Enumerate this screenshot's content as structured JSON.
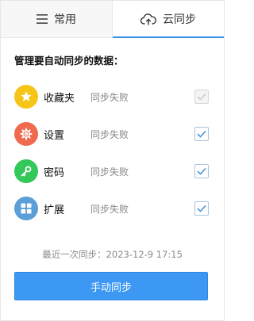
{
  "tabs": [
    {
      "label": "常用",
      "icon": "menu-icon",
      "active": false
    },
    {
      "label": "云同步",
      "icon": "cloud-upload-icon",
      "active": true
    }
  ],
  "colors": {
    "accent": "#3d98f3",
    "favorites": "#f5c518",
    "settings": "#ef6a4f",
    "passwords": "#34c759",
    "extensions": "#5a9fd8"
  },
  "heading": "管理要自动同步的数据：",
  "items": [
    {
      "label": "收藏夹",
      "status": "同步失败",
      "icon": "star-icon",
      "checked": true,
      "enabled": false
    },
    {
      "label": "设置",
      "status": "同步失败",
      "icon": "gear-icon",
      "checked": true,
      "enabled": true
    },
    {
      "label": "密码",
      "status": "同步失败",
      "icon": "key-icon",
      "checked": true,
      "enabled": true
    },
    {
      "label": "扩展",
      "status": "同步失败",
      "icon": "extensions-grid-icon",
      "checked": true,
      "enabled": true
    }
  ],
  "last_sync": "最近一次同步：2023-12-9 17:15",
  "sync_button": "手动同步"
}
